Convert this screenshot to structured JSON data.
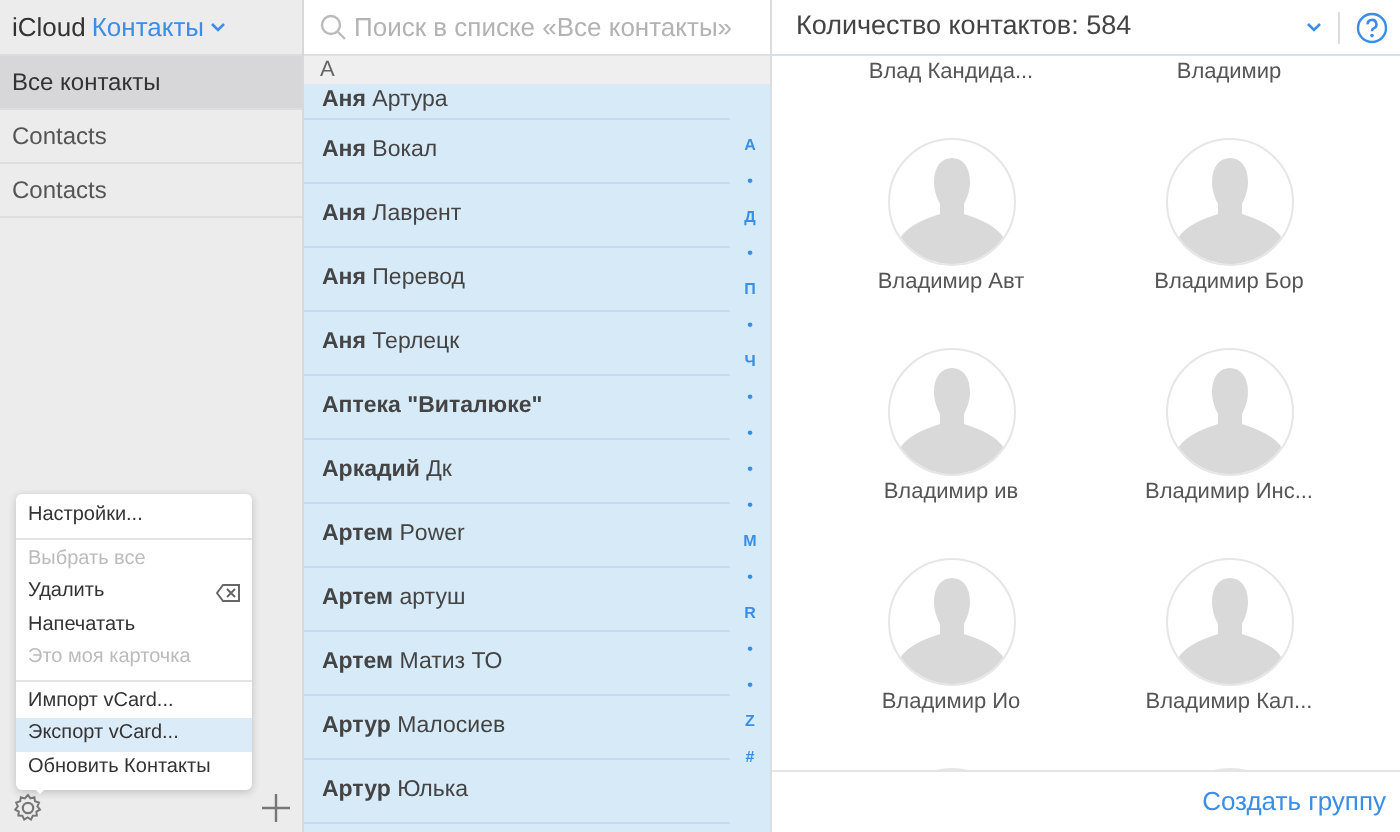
{
  "sidebar": {
    "brand": "iCloud",
    "app": "Контакты",
    "groups": [
      {
        "label": "Все контакты",
        "selected": true
      },
      {
        "label": "Contacts",
        "selected": false
      },
      {
        "label": "Contacts",
        "selected": false
      }
    ]
  },
  "menu": {
    "items": [
      {
        "kind": "item",
        "label": "Настройки...",
        "disabled": false,
        "selected": false
      },
      {
        "kind": "divider"
      },
      {
        "kind": "item",
        "label": "Выбрать все",
        "disabled": true,
        "selected": false
      },
      {
        "kind": "item",
        "label": "Удалить",
        "disabled": false,
        "selected": false,
        "key_icon": true
      },
      {
        "kind": "item",
        "label": "Напечатать",
        "disabled": false,
        "selected": false
      },
      {
        "kind": "item",
        "label": "Это моя карточка",
        "disabled": true,
        "selected": false
      },
      {
        "kind": "divider"
      },
      {
        "kind": "item",
        "label": "Импорт vCard...",
        "disabled": false,
        "selected": false
      },
      {
        "kind": "item",
        "label": "Экспорт vCard...",
        "disabled": false,
        "selected": true
      },
      {
        "kind": "item",
        "label": "Обновить Контакты",
        "disabled": false,
        "selected": false
      }
    ]
  },
  "list": {
    "search_placeholder": "Поиск в списке «Все контакты»",
    "section": "A",
    "rows": [
      {
        "first": "Аня",
        "last": "Артура",
        "selected": true
      },
      {
        "first": "Аня",
        "last": "Вокал",
        "selected": true
      },
      {
        "first": "Аня",
        "last": "Лаврент",
        "selected": true
      },
      {
        "first": "Аня",
        "last": "Перевод",
        "selected": true
      },
      {
        "first": "Аня",
        "last": "Терлецк",
        "selected": true
      },
      {
        "first": "Аптека \"Виталюке\"",
        "last": "",
        "selected": true
      },
      {
        "first": "Аркадий",
        "last": "Дк",
        "selected": true
      },
      {
        "first": "Артем",
        "last": "Power",
        "selected": true
      },
      {
        "first": "Артем",
        "last": "артуш",
        "selected": true
      },
      {
        "first": "Артем",
        "last": "Матиз ТО",
        "selected": true
      },
      {
        "first": "Артур",
        "last": "Малосиев",
        "selected": true
      },
      {
        "first": "Артур",
        "last": "Юлька",
        "selected": true
      }
    ],
    "index": [
      "А",
      "•",
      "Д",
      "•",
      "П",
      "•",
      "Ч",
      "•",
      "•",
      "•",
      "•",
      "M",
      "•",
      "R",
      "•",
      "•",
      "Z",
      "#"
    ]
  },
  "detail": {
    "count_label": "Количество контактов: 584",
    "columns": [
      [
        "Влад Кандида...",
        "Владимир Авт",
        "Владимир ив",
        "Владимир Ио"
      ],
      [
        "Владимир",
        "Владимир Бор",
        "Владимир Инс...",
        "Владимир Кал..."
      ]
    ],
    "footer_button": "Создать группу"
  }
}
